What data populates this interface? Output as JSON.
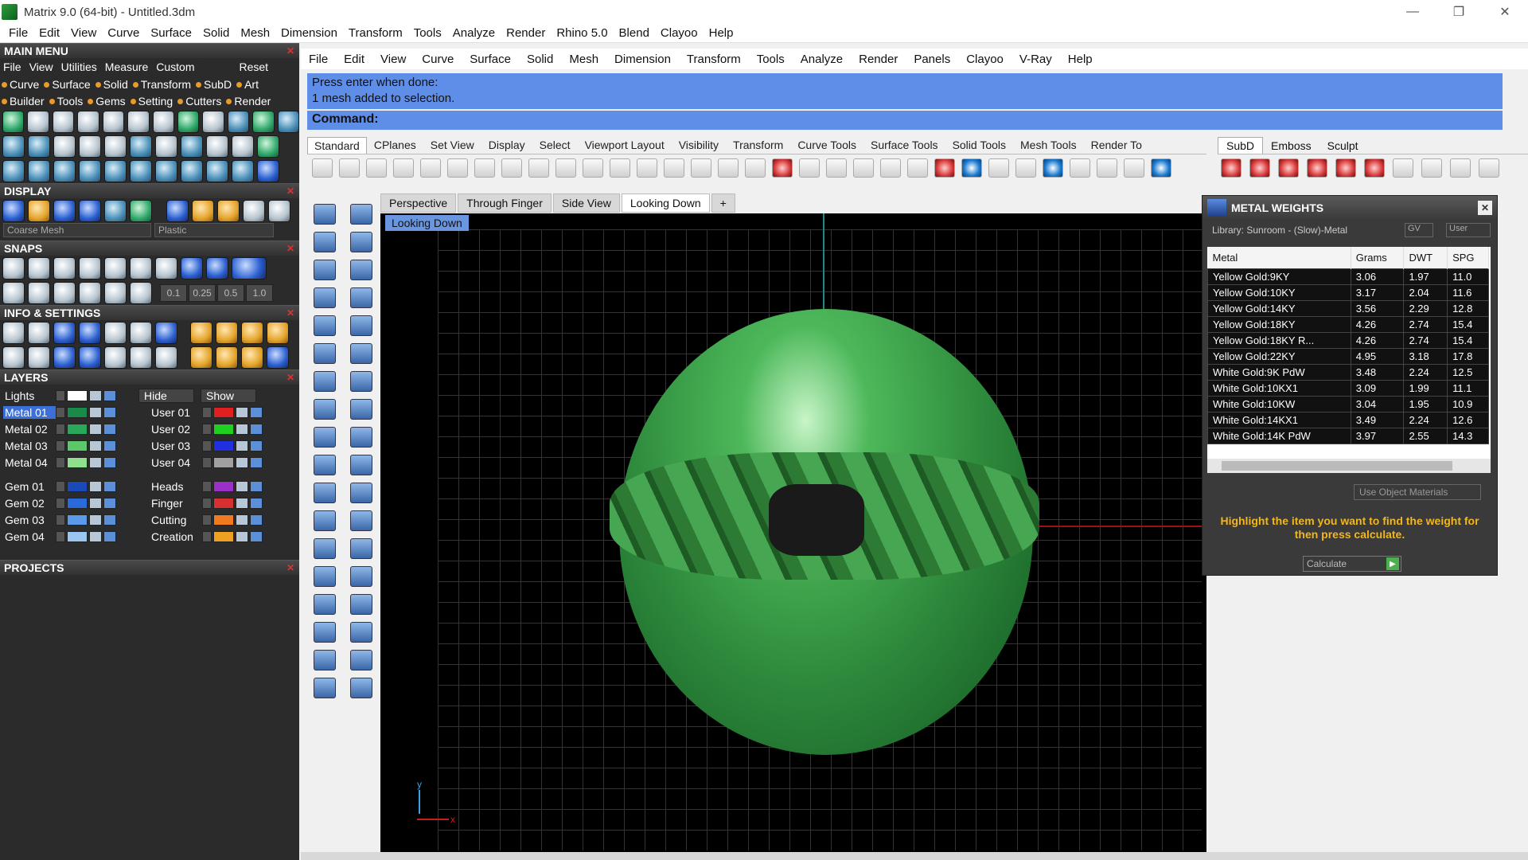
{
  "window": {
    "title": "Matrix 9.0 (64-bit) - Untitled.3dm",
    "minimize": "—",
    "restore": "❐",
    "close": "✕"
  },
  "menubar": [
    "File",
    "Edit",
    "View",
    "Curve",
    "Surface",
    "Solid",
    "Mesh",
    "Dimension",
    "Transform",
    "Tools",
    "Analyze",
    "Render",
    "Rhino 5.0",
    "Blend",
    "Clayoo",
    "Help"
  ],
  "left": {
    "main_menu": {
      "title": "MAIN MENU",
      "sub": [
        "File",
        "View",
        "Utilities",
        "Measure",
        "Custom"
      ],
      "reset": "Reset",
      "cats1": [
        "Curve",
        "Surface",
        "Solid",
        "Transform",
        "SubD",
        "Art"
      ],
      "cats2": [
        "Builder",
        "Tools",
        "Gems",
        "Setting",
        "Cutters",
        "Render"
      ]
    },
    "display": {
      "title": "DISPLAY",
      "mesh_select": "Coarse Mesh",
      "material_select": "Plastic"
    },
    "snaps": {
      "title": "SNAPS",
      "values": [
        "0.1",
        "0.25",
        "0.5",
        "1.0"
      ]
    },
    "info": {
      "title": "INFO & SETTINGS"
    },
    "layers": {
      "title": "LAYERS",
      "lights": "Lights",
      "hide": "Hide",
      "show": "Show",
      "left_items": [
        {
          "name": "Metal 01",
          "color": "#1a8a4a",
          "selected": true
        },
        {
          "name": "Metal 02",
          "color": "#2aa85a"
        },
        {
          "name": "Metal 03",
          "color": "#5cc86a"
        },
        {
          "name": "Metal 04",
          "color": "#8ee08e"
        },
        {
          "name": "Gem 01",
          "color": "#1a4ab8"
        },
        {
          "name": "Gem 02",
          "color": "#2a6ad8"
        },
        {
          "name": "Gem 03",
          "color": "#5a9ae8"
        },
        {
          "name": "Gem 04",
          "color": "#9ac6f0"
        }
      ],
      "right_items": [
        {
          "name": "User 01",
          "color": "#e02020"
        },
        {
          "name": "User 02",
          "color": "#20d020"
        },
        {
          "name": "User 03",
          "color": "#2030e0"
        },
        {
          "name": "User 04",
          "color": "#a0a0a0"
        },
        {
          "name": "Heads",
          "color": "#9a30c8"
        },
        {
          "name": "Finger",
          "color": "#d83030"
        },
        {
          "name": "Cutting",
          "color": "#f07a20"
        },
        {
          "name": "Creation",
          "color": "#f0a020"
        }
      ]
    },
    "projects": {
      "title": "PROJECTS"
    }
  },
  "command_menu": [
    "File",
    "Edit",
    "View",
    "Curve",
    "Surface",
    "Solid",
    "Mesh",
    "Dimension",
    "Transform",
    "Tools",
    "Analyze",
    "Render",
    "Panels",
    "Clayoo",
    "V-Ray",
    "Help"
  ],
  "command": {
    "history1": "Press enter when done:",
    "history2": "1 mesh added to selection.",
    "prompt": "Command:"
  },
  "toolbar_tabs": [
    "Standard",
    "CPlanes",
    "Set View",
    "Display",
    "Select",
    "Viewport Layout",
    "Visibility",
    "Transform",
    "Curve Tools",
    "Surface Tools",
    "Solid Tools",
    "Mesh Tools",
    "Render To"
  ],
  "right_tabs": [
    "SubD",
    "Emboss",
    "Sculpt"
  ],
  "viewport_tabs": [
    "Perspective",
    "Through Finger",
    "Side View",
    "Looking Down",
    "+"
  ],
  "viewport": {
    "label": "Looking Down",
    "axis_y": "y",
    "axis_x": "x"
  },
  "metal_weights": {
    "title": "METAL WEIGHTS",
    "library": "Library: Sunroom - (Slow)-Metal",
    "gv": "GV",
    "user": "User",
    "columns": [
      "Metal",
      "Grams",
      "DWT",
      "SPG"
    ],
    "rows": [
      [
        "Yellow Gold:9KY",
        "3.06",
        "1.97",
        "11.0"
      ],
      [
        "Yellow Gold:10KY",
        "3.17",
        "2.04",
        "11.6"
      ],
      [
        "Yellow Gold:14KY",
        "3.56",
        "2.29",
        "12.8"
      ],
      [
        "Yellow Gold:18KY",
        "4.26",
        "2.74",
        "15.4"
      ],
      [
        "Yellow Gold:18KY R...",
        "4.26",
        "2.74",
        "15.4"
      ],
      [
        "Yellow Gold:22KY",
        "4.95",
        "3.18",
        "17.8"
      ],
      [
        "White Gold:9K PdW",
        "3.48",
        "2.24",
        "12.5"
      ],
      [
        "White Gold:10KX1",
        "3.09",
        "1.99",
        "11.1"
      ],
      [
        "White Gold:10KW",
        "3.04",
        "1.95",
        "10.9"
      ],
      [
        "White Gold:14KX1",
        "3.49",
        "2.24",
        "12.6"
      ],
      [
        "White Gold:14K PdW",
        "3.97",
        "2.55",
        "14.3"
      ]
    ],
    "use_object_materials": "Use Object Materials",
    "hint": "Highlight the item you want to find the weight for then press calculate.",
    "calculate": "Calculate"
  }
}
